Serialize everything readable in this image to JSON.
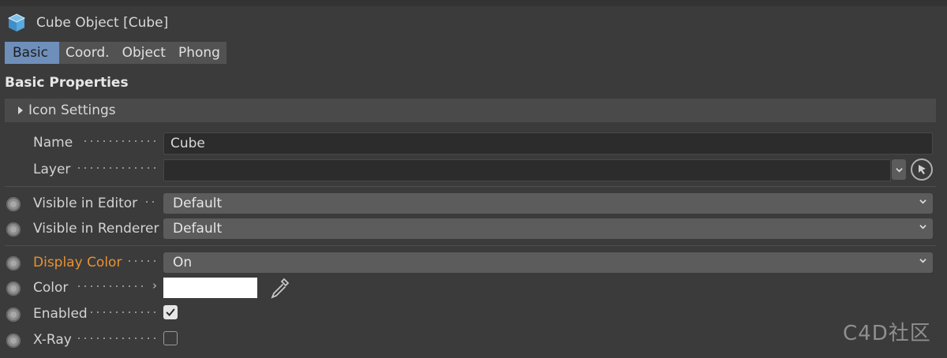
{
  "header": {
    "title": "Cube Object [Cube]",
    "icon": "cube-icon"
  },
  "tabs": [
    {
      "label": "Basic",
      "active": true
    },
    {
      "label": "Coord.",
      "active": false
    },
    {
      "label": "Object",
      "active": false
    },
    {
      "label": "Phong",
      "active": false
    }
  ],
  "section": {
    "title": "Basic Properties"
  },
  "icon_settings": {
    "label": "Icon Settings"
  },
  "fields": {
    "name": {
      "label": "Name",
      "value": "Cube"
    },
    "layer": {
      "label": "Layer",
      "value": ""
    },
    "visible_editor": {
      "label": "Visible in Editor",
      "value": "Default"
    },
    "visible_renderer": {
      "label": "Visible in Renderer",
      "value": "Default"
    },
    "display_color": {
      "label": "Display Color",
      "value": "On",
      "label_color": "#e89233"
    },
    "color": {
      "label": "Color",
      "value": "#ffffff"
    },
    "enabled": {
      "label": "Enabled",
      "checked": true
    },
    "xray": {
      "label": "X-Ray",
      "checked": false
    }
  },
  "watermark": "C4D社区",
  "colors": {
    "background": "#3b3b3b",
    "tab_active": "#6f8fbb",
    "accent_orange": "#e89233"
  }
}
